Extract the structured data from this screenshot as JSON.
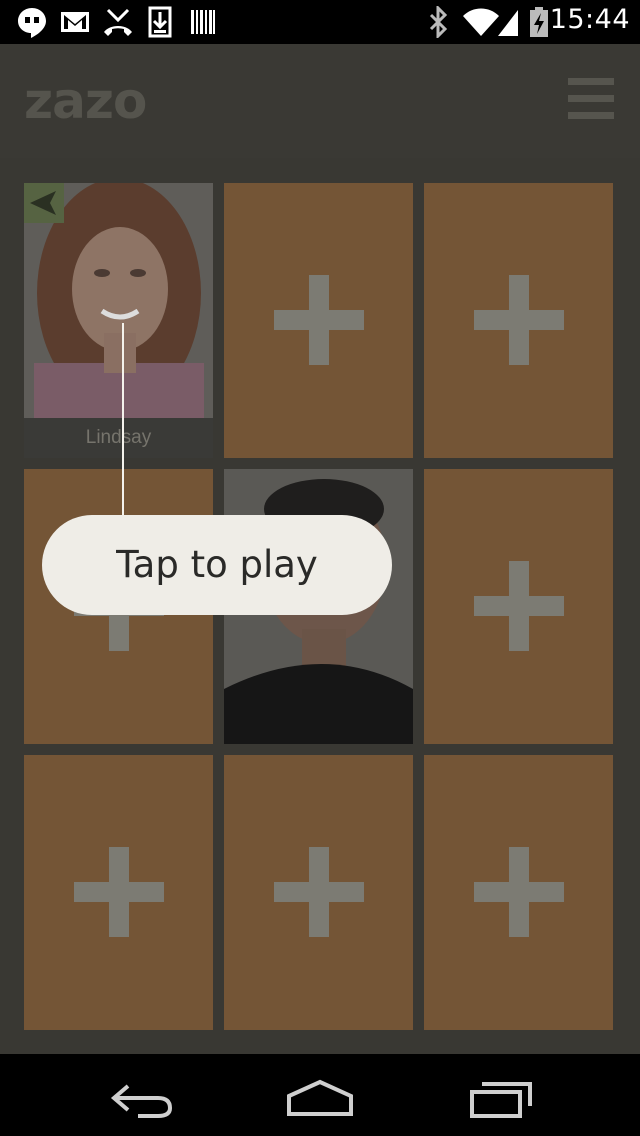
{
  "status_bar": {
    "time": "15:44",
    "left_icons": [
      "hangouts-icon",
      "gmail-icon",
      "missed-call-icon",
      "download-icon",
      "barcode-icon"
    ],
    "right_icons": [
      "bluetooth-icon",
      "wifi-icon",
      "signal-icon",
      "battery-charging-icon"
    ]
  },
  "header": {
    "logo": "zazo",
    "menu_icon": "hamburger-menu-icon"
  },
  "grid": {
    "tiles": [
      {
        "type": "friend",
        "name": "Lindsay",
        "badge": "send-icon"
      },
      {
        "type": "add"
      },
      {
        "type": "add"
      },
      {
        "type": "add"
      },
      {
        "type": "self"
      },
      {
        "type": "add"
      },
      {
        "type": "add"
      },
      {
        "type": "add"
      },
      {
        "type": "add"
      }
    ]
  },
  "hint": {
    "text": "Tap to play"
  },
  "nav_bar": {
    "buttons": [
      "back-icon",
      "home-icon",
      "recent-apps-icon"
    ]
  },
  "colors": {
    "tile_add": "#745536",
    "plus": "#7c7b73",
    "bubble": "#efede7"
  }
}
